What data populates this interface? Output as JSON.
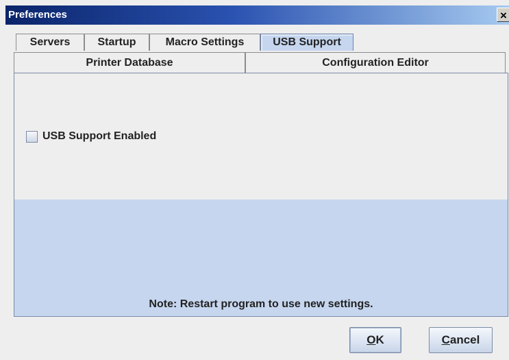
{
  "window": {
    "title": "Preferences",
    "close_glyph": "×"
  },
  "tabs_row1": [
    {
      "label": "Servers",
      "selected": false
    },
    {
      "label": "Startup",
      "selected": false
    },
    {
      "label": "Macro Settings",
      "selected": false
    },
    {
      "label": "USB Support",
      "selected": true
    }
  ],
  "tabs_row2": [
    {
      "label": "Printer Database",
      "selected": false
    },
    {
      "label": "Configuration Editor",
      "selected": false
    }
  ],
  "usb_panel": {
    "checkbox_label": "USB Support Enabled",
    "checkbox_checked": false,
    "note": "Note: Restart program to use new settings."
  },
  "buttons": {
    "ok_mnemonic": "O",
    "ok_rest": "K",
    "cancel_mnemonic": "C",
    "cancel_rest": "ancel"
  },
  "colors": {
    "selected_tab": "#c6d6ef",
    "panel_lower": "#c6d6ef",
    "title_bar": "#0a246a",
    "background": "#eeeeee"
  }
}
